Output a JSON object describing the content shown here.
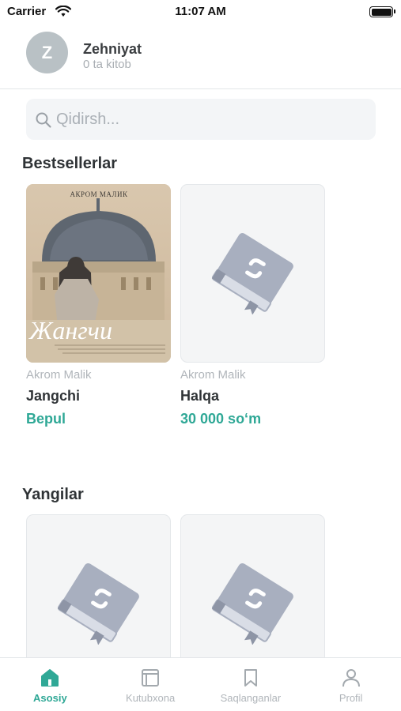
{
  "status_bar": {
    "carrier": "Carrier",
    "time": "11:07 AM"
  },
  "profile": {
    "initial": "Z",
    "name": "Zehniyat",
    "subtitle": "0 ta kitob"
  },
  "search": {
    "placeholder": "Qidirsh..."
  },
  "sections": [
    {
      "title": "Bestsellerlar",
      "books": [
        {
          "author": "Akrom Malik",
          "title": "Jangchi",
          "price": "Bepul",
          "cover_author": "АКРОМ МАЛИК",
          "cover_title": "Жангчи",
          "cover": "image"
        },
        {
          "author": "Akrom Malik",
          "title": "Halqa",
          "price": "30 000 so‘m",
          "cover": "placeholder"
        }
      ]
    },
    {
      "title": "Yangilar",
      "books": [
        {
          "cover": "placeholder"
        },
        {
          "cover": "placeholder"
        }
      ]
    }
  ],
  "bottom_nav": [
    {
      "label": "Asosiy",
      "icon": "home-icon",
      "active": true
    },
    {
      "label": "Kutubxona",
      "icon": "library-icon",
      "active": false
    },
    {
      "label": "Saqlanganlar",
      "icon": "bookmark-icon",
      "active": false
    },
    {
      "label": "Profil",
      "icon": "profile-icon",
      "active": false
    }
  ],
  "colors": {
    "accent": "#2fa896",
    "muted": "#b0b5ba",
    "placeholder_book": "#a6adbd"
  }
}
